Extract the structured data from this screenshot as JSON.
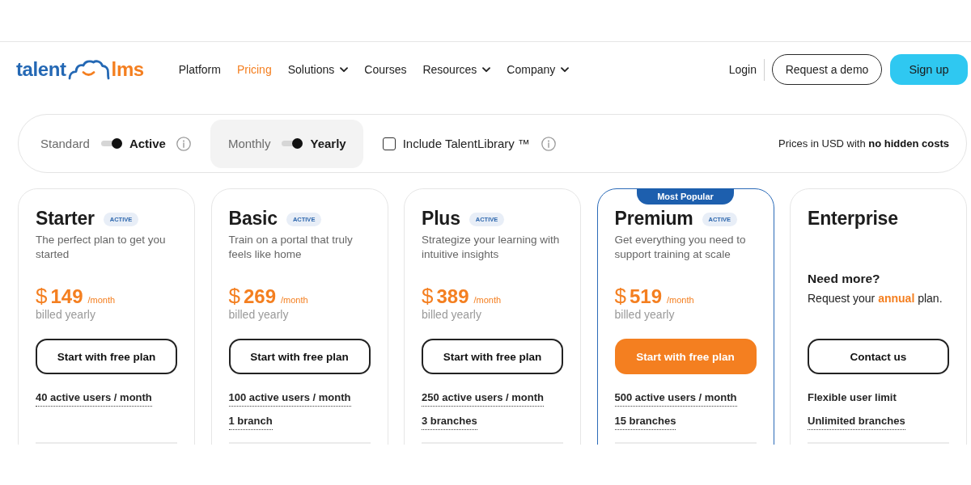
{
  "header": {
    "logo": {
      "primary": "talent",
      "secondary": "lms"
    },
    "nav": [
      {
        "label": "Platform",
        "selected": false,
        "dropdown": false
      },
      {
        "label": "Pricing",
        "selected": true,
        "dropdown": false
      },
      {
        "label": "Solutions",
        "selected": false,
        "dropdown": true
      },
      {
        "label": "Courses",
        "selected": false,
        "dropdown": false
      },
      {
        "label": "Resources",
        "selected": false,
        "dropdown": true
      },
      {
        "label": "Company",
        "selected": false,
        "dropdown": true
      }
    ],
    "login": "Login",
    "demo_button": "Request a demo",
    "signup_button": "Sign up"
  },
  "filters": {
    "toggles": [
      {
        "off_label": "Standard",
        "on_label": "Active",
        "on": true,
        "info": true,
        "highlighted": false
      },
      {
        "off_label": "Monthly",
        "on_label": "Yearly",
        "on": true,
        "info": false,
        "highlighted": true
      }
    ],
    "library": {
      "label": "Include TalentLibrary ™",
      "checked": false,
      "info": true
    },
    "note": "Prices in USD with **no hidden costs**"
  },
  "plans": [
    {
      "kind": "priced",
      "name": "Starter",
      "badge": "ACTIVE",
      "highlighted": false,
      "description": "The perfect plan to get you started",
      "currency": "$",
      "price": "149",
      "period": "/month",
      "billing": "billed yearly",
      "button": "Start with free plan",
      "features": [
        {
          "text": "40 active users / month",
          "underlined": true
        }
      ]
    },
    {
      "kind": "priced",
      "name": "Basic",
      "badge": "ACTIVE",
      "highlighted": false,
      "description": "Train on a portal that truly feels like home",
      "currency": "$",
      "price": "269",
      "period": "/month",
      "billing": "billed yearly",
      "button": "Start with free plan",
      "features": [
        {
          "text": "100 active users / month",
          "underlined": true
        },
        {
          "text": "1 branch",
          "underlined": true
        }
      ]
    },
    {
      "kind": "priced",
      "name": "Plus",
      "badge": "ACTIVE",
      "highlighted": false,
      "description": "Strategize your learning with intuitive insights",
      "currency": "$",
      "price": "389",
      "period": "/month",
      "billing": "billed yearly",
      "button": "Start with free plan",
      "features": [
        {
          "text": "250 active users / month",
          "underlined": true
        },
        {
          "text": "3 branches",
          "underlined": true
        }
      ]
    },
    {
      "kind": "priced",
      "name": "Premium",
      "badge": "ACTIVE",
      "highlighted": true,
      "ribbon": "Most Popular",
      "description": "Get everything you need to support training at scale",
      "currency": "$",
      "price": "519",
      "period": "/month",
      "billing": "billed yearly",
      "button": "Start with free plan",
      "features": [
        {
          "text": "500 active users / month",
          "underlined": true
        },
        {
          "text": "15 branches",
          "underlined": true
        }
      ]
    },
    {
      "kind": "custom",
      "name": "Enterprise",
      "highlighted": false,
      "question": "Need more?",
      "request": "Request your **annual** plan.",
      "button": "Contact us",
      "features": [
        {
          "text": "Flexible user limit",
          "underlined": false
        },
        {
          "text": "Unlimited branches",
          "underlined": true
        }
      ]
    }
  ]
}
